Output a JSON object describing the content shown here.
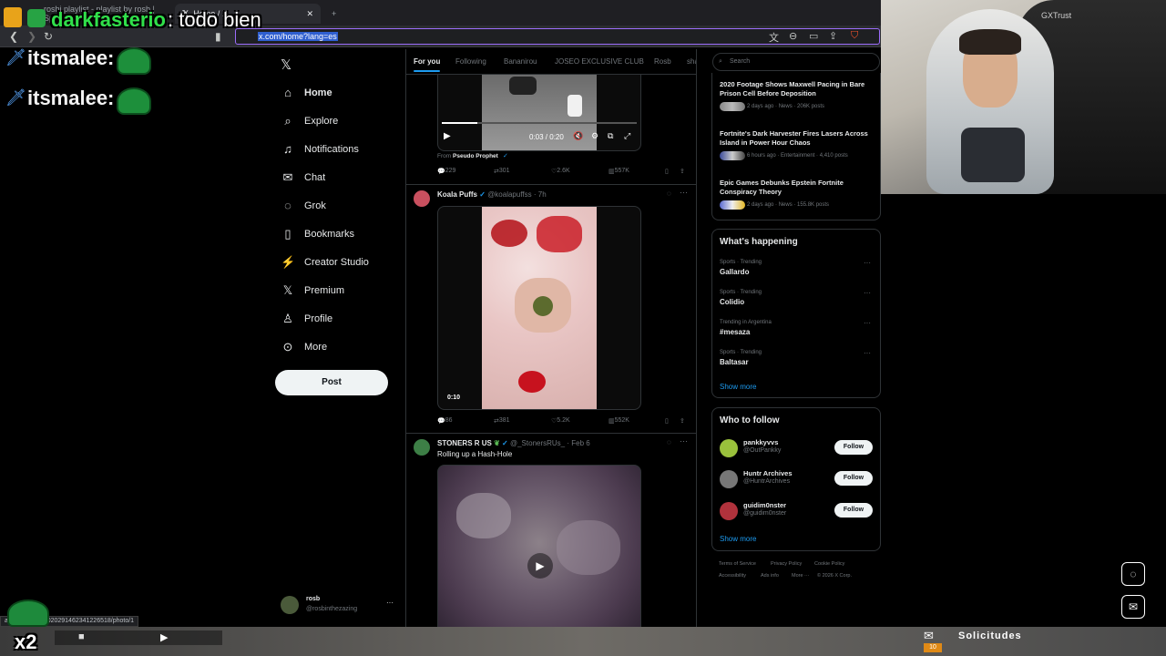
{
  "browser": {
    "tabs": [
      {
        "label": "roshi playlist - playlist by rosb | Spoti"
      },
      {
        "label": "Home / X"
      }
    ],
    "url_highlight": "x.com/home?lang=es",
    "status_url": "ai_cs_/status/2020291462341226518/photo/1"
  },
  "overlay": {
    "chat_top_user": "darkfasterio",
    "chat_top_msg": ": todo bien",
    "chat_lines": [
      {
        "user": "itsmalee:"
      },
      {
        "user": "itsmalee:"
      }
    ],
    "badge_x2": "x2",
    "notif_label": "Solicitudes",
    "notif_count": "10"
  },
  "nav": {
    "items": [
      {
        "label": "Home",
        "icon": "home-icon"
      },
      {
        "label": "Explore",
        "icon": "search-icon"
      },
      {
        "label": "Notifications",
        "icon": "bell-icon"
      },
      {
        "label": "Chat",
        "icon": "chat-icon"
      },
      {
        "label": "Grok",
        "icon": "grok-icon"
      },
      {
        "label": "Bookmarks",
        "icon": "bookmark-icon"
      },
      {
        "label": "Creator Studio",
        "icon": "studio-icon"
      },
      {
        "label": "Premium",
        "icon": "x-icon"
      },
      {
        "label": "Profile",
        "icon": "person-icon"
      },
      {
        "label": "More",
        "icon": "more-icon"
      }
    ],
    "post_label": "Post",
    "account_name": "rosb",
    "account_handle": "@rosbinthezazing"
  },
  "feed": {
    "tabs": [
      "For you",
      "Following",
      "Bananirou",
      "JOSEO EXCLUSIVE CLUB",
      "Rosb",
      "sha"
    ],
    "post1": {
      "time": "0:03 / 0:20",
      "from_label": "From",
      "from_name": "Pseudo Prophet",
      "replies": "229",
      "reposts": "301",
      "likes": "2.6K",
      "views": "557K"
    },
    "post2": {
      "name": "Koala Puffs",
      "handle": "@koalapuffss · 7h",
      "duration": "0:10",
      "replies": "86",
      "reposts": "381",
      "likes": "5.2K",
      "views": "552K"
    },
    "post3": {
      "name": "STONERS R US",
      "handle": "@_StonersRUs_ · Feb 6",
      "text": "Rolling up a Hash-Hole"
    }
  },
  "right": {
    "search_placeholder": "Search",
    "news": [
      {
        "title": "2020 Footage Shows Maxwell Pacing in Bare Prison Cell Before Deposition",
        "meta": "2 days ago · News · 206K posts"
      },
      {
        "title": "Fortnite's Dark Harvester Fires Lasers Across Island in Power Hour Chaos",
        "meta": "6 hours ago · Entertainment · 4,410 posts"
      },
      {
        "title": "Epic Games Debunks Epstein Fortnite Conspiracy Theory",
        "meta": "2 days ago · News · 155.8K posts"
      }
    ],
    "happening_title": "What's happening",
    "trends": [
      {
        "cat": "Sports · Trending",
        "name": "Gallardo"
      },
      {
        "cat": "Sports · Trending",
        "name": "Colidio"
      },
      {
        "cat": "Trending in Argentina",
        "name": "#mesaza"
      },
      {
        "cat": "Sports · Trending",
        "name": "Baltasar"
      }
    ],
    "show_more": "Show more",
    "wtf_title": "Who to follow",
    "follow": [
      {
        "name": "pankkyvvs",
        "handle": "@OutPankky"
      },
      {
        "name": "Huntr Archives",
        "handle": "@HuntrArchives"
      },
      {
        "name": "guidim0nster",
        "handle": "@guidim0nster"
      }
    ],
    "follow_label": "Follow",
    "footer": [
      "Terms of Service",
      "Privacy Policy",
      "Cookie Policy",
      "Accessibility",
      "Ads info",
      "More ···",
      "© 2026 X Corp."
    ]
  },
  "webcam": {
    "watermark": "GXTrust"
  }
}
